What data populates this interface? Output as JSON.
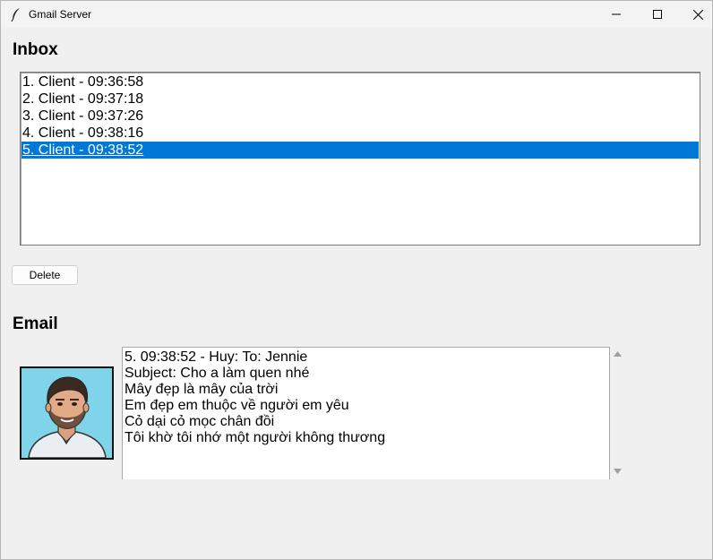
{
  "window": {
    "title": "Gmail Server",
    "icons": {
      "app": "feather-icon",
      "minimize": "minimize-icon",
      "maximize": "maximize-icon",
      "close": "close-icon"
    }
  },
  "inbox": {
    "title": "Inbox",
    "items": [
      "1. Client - 09:36:58",
      "2. Client - 09:37:18",
      "3. Client - 09:37:26",
      "4. Client - 09:38:16",
      "5. Client - 09:38:52"
    ],
    "selected_index": 4
  },
  "actions": {
    "delete_label": "Delete"
  },
  "email": {
    "title": "Email",
    "avatar": "avatar-man-illustration",
    "lines": [
      "5. 09:38:52 - Huy: To: Jennie",
      "Subject: Cho a làm quen nhé",
      "Mây đẹp là mây của trời",
      "Em đẹp em thuộc về người em yêu",
      "Cỏ dại cỏ mọc chân đồi",
      "Tôi khờ tôi nhớ một người không thương"
    ]
  },
  "colors": {
    "selection": "#0078d7",
    "background": "#f0f0f0",
    "avatar_bg": "#7fd4ea"
  }
}
